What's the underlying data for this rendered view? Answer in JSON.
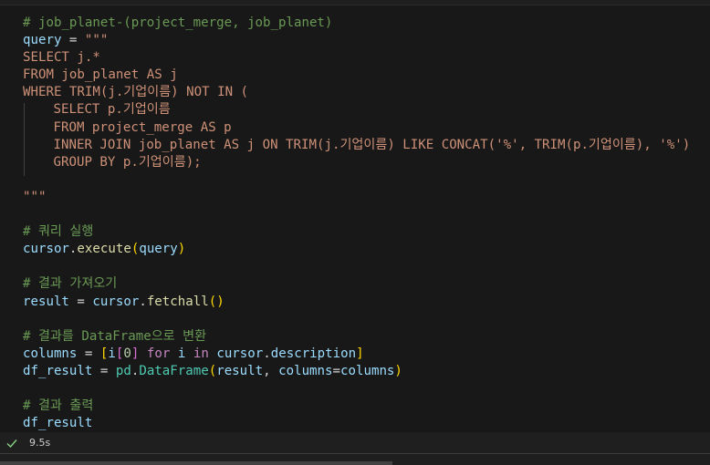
{
  "cell": {
    "lines": [
      {
        "t": [
          {
            "c": "c",
            "v": "# job_planet-(project_merge, job_planet)"
          }
        ]
      },
      {
        "t": [
          {
            "c": "v",
            "v": "query"
          },
          {
            "c": "p",
            "v": " = "
          },
          {
            "c": "s",
            "v": "\"\"\""
          }
        ]
      },
      {
        "t": [
          {
            "c": "s",
            "v": "SELECT j.*"
          }
        ]
      },
      {
        "t": [
          {
            "c": "s",
            "v": "FROM job_planet AS j"
          }
        ]
      },
      {
        "t": [
          {
            "c": "s",
            "v": "WHERE TRIM(j.기업이름) NOT IN ("
          }
        ]
      },
      {
        "i": 1,
        "t": [
          {
            "c": "s",
            "v": "SELECT p.기업이름"
          }
        ]
      },
      {
        "i": 1,
        "t": [
          {
            "c": "s",
            "v": "FROM project_merge AS p"
          }
        ]
      },
      {
        "i": 1,
        "t": [
          {
            "c": "s",
            "v": "INNER JOIN job_planet AS j ON TRIM(j.기업이름) LIKE CONCAT('%', TRIM(p.기업이름), '%')"
          }
        ]
      },
      {
        "i": 1,
        "t": [
          {
            "c": "s",
            "v": "GROUP BY p.기업이름);"
          }
        ]
      },
      {
        "t": []
      },
      {
        "t": [
          {
            "c": "s",
            "v": "\"\"\""
          }
        ]
      },
      {
        "t": []
      },
      {
        "t": [
          {
            "c": "c",
            "v": "# 쿼리 실행"
          }
        ]
      },
      {
        "t": [
          {
            "c": "v",
            "v": "cursor"
          },
          {
            "c": "p",
            "v": "."
          },
          {
            "c": "f",
            "v": "execute"
          },
          {
            "c": "b1",
            "v": "("
          },
          {
            "c": "v",
            "v": "query"
          },
          {
            "c": "b1",
            "v": ")"
          }
        ]
      },
      {
        "t": []
      },
      {
        "t": [
          {
            "c": "c",
            "v": "# 결과 가져오기"
          }
        ]
      },
      {
        "t": [
          {
            "c": "v",
            "v": "result"
          },
          {
            "c": "p",
            "v": " = "
          },
          {
            "c": "v",
            "v": "cursor"
          },
          {
            "c": "p",
            "v": "."
          },
          {
            "c": "f",
            "v": "fetchall"
          },
          {
            "c": "b1",
            "v": "()"
          }
        ]
      },
      {
        "t": []
      },
      {
        "t": [
          {
            "c": "c",
            "v": "# 결과를 DataFrame으로 변환"
          }
        ]
      },
      {
        "t": [
          {
            "c": "v",
            "v": "columns"
          },
          {
            "c": "p",
            "v": " = "
          },
          {
            "c": "b1",
            "v": "["
          },
          {
            "c": "v",
            "v": "i"
          },
          {
            "c": "b2",
            "v": "["
          },
          {
            "c": "n",
            "v": "0"
          },
          {
            "c": "b2",
            "v": "]"
          },
          {
            "c": "p",
            "v": " "
          },
          {
            "c": "k",
            "v": "for"
          },
          {
            "c": "p",
            "v": " "
          },
          {
            "c": "v",
            "v": "i"
          },
          {
            "c": "p",
            "v": " "
          },
          {
            "c": "k",
            "v": "in"
          },
          {
            "c": "p",
            "v": " "
          },
          {
            "c": "v",
            "v": "cursor"
          },
          {
            "c": "p",
            "v": "."
          },
          {
            "c": "v",
            "v": "description"
          },
          {
            "c": "b1",
            "v": "]"
          }
        ]
      },
      {
        "t": [
          {
            "c": "v",
            "v": "df_result"
          },
          {
            "c": "p",
            "v": " = "
          },
          {
            "c": "t",
            "v": "pd"
          },
          {
            "c": "p",
            "v": "."
          },
          {
            "c": "t",
            "v": "DataFrame"
          },
          {
            "c": "b1",
            "v": "("
          },
          {
            "c": "v",
            "v": "result"
          },
          {
            "c": "p",
            "v": ", "
          },
          {
            "c": "v",
            "v": "columns"
          },
          {
            "c": "p",
            "v": "="
          },
          {
            "c": "v",
            "v": "columns"
          },
          {
            "c": "b1",
            "v": ")"
          }
        ]
      },
      {
        "t": []
      },
      {
        "t": [
          {
            "c": "c",
            "v": "# 결과 출력"
          }
        ]
      },
      {
        "t": [
          {
            "c": "v",
            "v": "df_result"
          }
        ]
      }
    ]
  },
  "status": {
    "check_icon": "check-icon",
    "time": "9.5s"
  }
}
